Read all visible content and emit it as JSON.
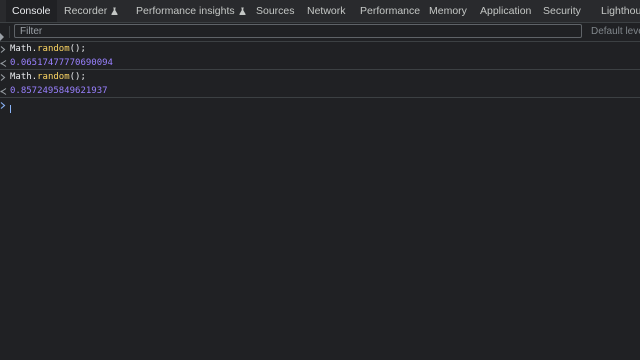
{
  "tabs": [
    {
      "label": "Console",
      "active": true,
      "experimental": false
    },
    {
      "label": "Recorder",
      "active": false,
      "experimental": true
    },
    {
      "label": "Performance insights",
      "active": false,
      "experimental": true
    },
    {
      "label": "Sources",
      "active": false,
      "experimental": false
    },
    {
      "label": "Network",
      "active": false,
      "experimental": false
    },
    {
      "label": "Performance",
      "active": false,
      "experimental": false
    },
    {
      "label": "Memory",
      "active": false,
      "experimental": false
    },
    {
      "label": "Application",
      "active": false,
      "experimental": false
    },
    {
      "label": "Security",
      "active": false,
      "experimental": false
    },
    {
      "label": "Lighthouse",
      "active": false,
      "experimental": false
    }
  ],
  "toolbar": {
    "filter_placeholder": "Filter",
    "levels_label": "Default levels"
  },
  "console": {
    "entries": [
      {
        "input": {
          "object": "Math",
          "dot": ".",
          "method": "random",
          "call": "();"
        },
        "result": "0.06517477770690094"
      },
      {
        "input": {
          "object": "Math",
          "dot": ".",
          "method": "random",
          "call": "();"
        },
        "result": "0.8572495849621937"
      }
    ]
  },
  "colors": {
    "background": "#202124",
    "tab_bar": "#292a2d",
    "prompt_accent": "#8ab4f8",
    "method_token": "#fdd663",
    "number_token": "#9980ff"
  },
  "icons": {
    "input_marker": "chevron-right-icon",
    "result_marker": "return-arrow-icon",
    "experimental_marker": "flask-icon"
  }
}
